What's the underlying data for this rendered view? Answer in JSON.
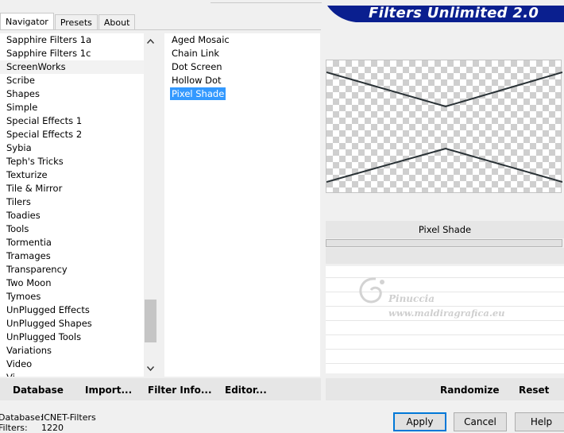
{
  "tabs": [
    "Navigator",
    "Presets",
    "About"
  ],
  "banner": {
    "title": "Filters Unlimited 2.0"
  },
  "categories": [
    "Sapphire Filters 1a",
    "Sapphire Filters 1c",
    "ScreenWorks",
    "Scribe",
    "Shapes",
    "Simple",
    "Special Effects 1",
    "Special Effects 2",
    "Sybia",
    "Teph's Tricks",
    "Texturize",
    "Tile & Mirror",
    "Tilers",
    "Toadies",
    "Tools",
    "Tormentia",
    "Tramages",
    "Transparency",
    "Two Moon",
    "Tymoes",
    "UnPlugged Effects",
    "UnPlugged Shapes",
    "UnPlugged Tools",
    "Variations",
    "Video",
    "Vi..."
  ],
  "filters": [
    "Aged Mosaic",
    "Chain Link",
    "Dot Screen",
    "Hollow Dot",
    "Pixel Shade"
  ],
  "selected_filter_name": "Pixel Shade",
  "watermark": {
    "line1": "Pinuccia",
    "line2": "www.maldiragrafica.eu"
  },
  "toolbar": {
    "database": "Database",
    "import": "Import...",
    "filter_info": "Filter Info...",
    "editor": "Editor...",
    "randomize": "Randomize",
    "reset": "Reset"
  },
  "info": {
    "database_label": "Database:",
    "database_value": "ICNET-Filters",
    "filters_label": "Filters:",
    "filters_value": "1220"
  },
  "buttons": {
    "apply": "Apply",
    "cancel": "Cancel",
    "help": "Help"
  },
  "colors": {
    "banner": "#0a1f8f",
    "selection": "#3399ff"
  },
  "icons": {
    "scroll_up": "chevron-up-icon",
    "scroll_down": "chevron-down-icon"
  }
}
